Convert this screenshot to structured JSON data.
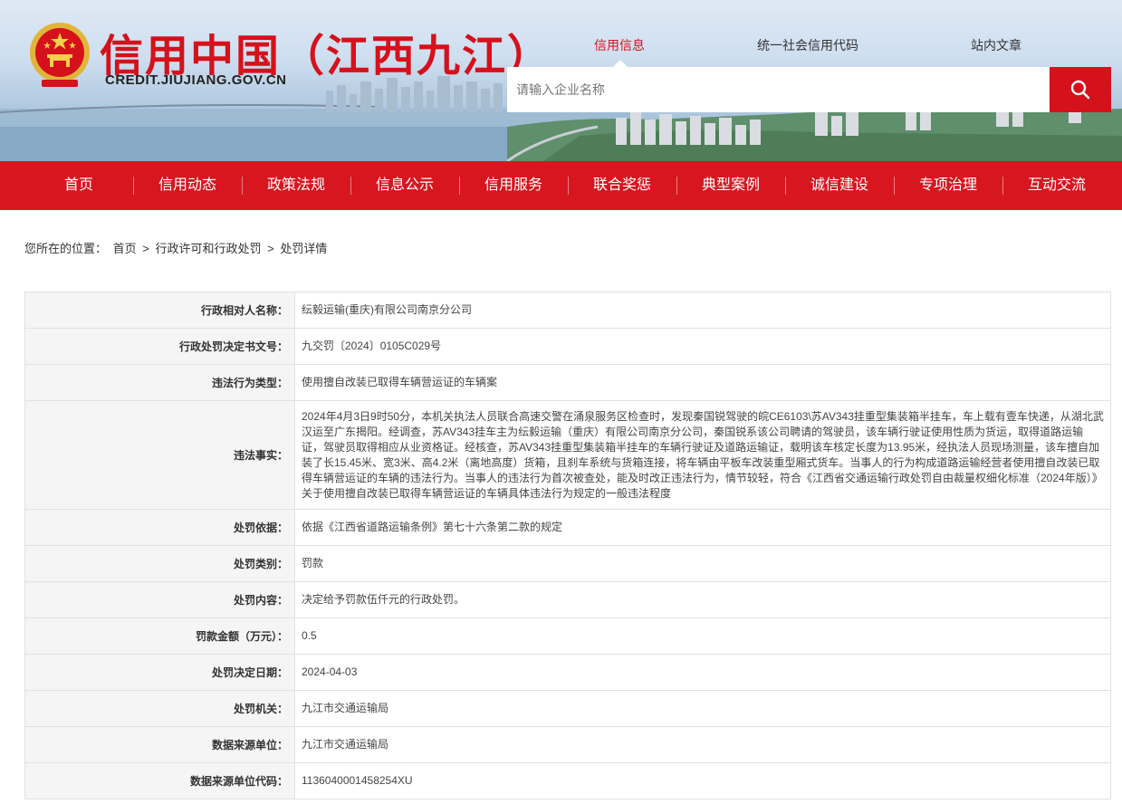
{
  "header": {
    "site_title": "信用中国（江西九江）",
    "site_domain": "CREDIT.JIUJIANG.GOV.CN",
    "emblem_icon": "national-emblem-icon",
    "search_tabs": [
      "信用信息",
      "统一社会信用代码",
      "站内文章"
    ],
    "active_tab": "信用信息",
    "search_placeholder": "请输入企业名称",
    "search_icon": "search-icon"
  },
  "nav": {
    "items": [
      "首页",
      "信用动态",
      "政策法规",
      "信息公示",
      "信用服务",
      "联合奖惩",
      "典型案例",
      "诚信建设",
      "专项治理",
      "互动交流"
    ]
  },
  "breadcrumb": {
    "prefix": "您所在的位置：",
    "items": [
      "首页",
      "行政许可和行政处罚",
      "处罚详情"
    ],
    "separator": ">"
  },
  "detail": [
    {
      "label": "行政相对人名称：",
      "value": "纭毅运输(重庆)有限公司南京分公司"
    },
    {
      "label": "行政处罚决定书文号：",
      "value": "九交罚〔2024〕0105C029号"
    },
    {
      "label": "违法行为类型：",
      "value": "使用擅自改装已取得车辆营运证的车辆案"
    },
    {
      "label": "违法事实：",
      "value": "2024年4月3日9时50分，本机关执法人员联合高速交警在涌泉服务区检查时，发现秦国锐驾驶的皖CE6103\\苏AV343挂重型集装箱半挂车，车上载有壹车快递，从湖北武汉运至广东揭阳。经调查，苏AV343挂车主为纭毅运输（重庆）有限公司南京分公司，秦国锐系该公司聘请的驾驶员，该车辆行驶证使用性质为货运，取得道路运输证，驾驶员取得相应从业资格证。经核查，苏AV343挂重型集装箱半挂车的车辆行驶证及道路运输证，载明该车核定长度为13.95米，经执法人员现场测量，该车擅自加装了长15.45米、宽3米、高4.2米（离地高度）货箱，且刹车系统与货箱连接，将车辆由平板车改装重型厢式货车。当事人的行为构成道路运输经营者使用擅自改装已取得车辆营运证的车辆的违法行为。当事人的违法行为首次被查处，能及时改正违法行为，情节较轻，符合《江西省交通运输行政处罚自由裁量权细化标准（2024年版）》关于使用擅自改装已取得车辆营运证的车辆具体违法行为规定的一般违法程度"
    },
    {
      "label": "处罚依据：",
      "value": "依据《江西省道路运输条例》第七十六条第二款的规定"
    },
    {
      "label": "处罚类别：",
      "value": "罚款"
    },
    {
      "label": "处罚内容：",
      "value": "决定给予罚款伍仟元的行政处罚。"
    },
    {
      "label": "罚款金额（万元）：",
      "value": "0.5"
    },
    {
      "label": "处罚决定日期：",
      "value": "2024-04-03"
    },
    {
      "label": "处罚机关：",
      "value": "九江市交通运输局"
    },
    {
      "label": "数据来源单位：",
      "value": "九江市交通运输局"
    },
    {
      "label": "数据来源单位代码：",
      "value": "1136040001458254XU"
    }
  ],
  "colors": {
    "brand_red": "#d7161f",
    "title_red": "#d5111b",
    "label_bg": "#f5f5f5",
    "border": "#e1e1e1"
  }
}
